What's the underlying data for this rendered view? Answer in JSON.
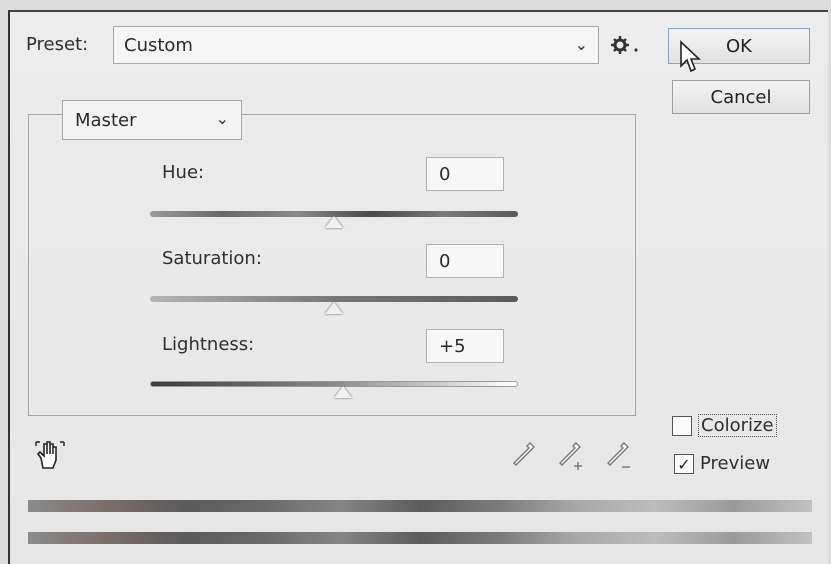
{
  "preset": {
    "label": "Preset:",
    "value": "Custom"
  },
  "buttons": {
    "ok": "OK",
    "cancel": "Cancel"
  },
  "channel": {
    "value": "Master"
  },
  "sliders": [
    {
      "label": "Hue:",
      "value": "0",
      "level": 0.5
    },
    {
      "label": "Saturation:",
      "value": "0",
      "level": 0.5
    },
    {
      "label": "Lightness:",
      "value": "+5",
      "level": 0.525
    }
  ],
  "options": {
    "colorize": "Colorize",
    "preview": "Preview",
    "colorize_checked": false,
    "preview_checked": true
  },
  "icons": [
    "chevron-down-icon",
    "gear-icon",
    "pointer-cursor-icon",
    "hand-adjust-icon",
    "eyedropper-icon",
    "eyedropper-plus-icon",
    "eyedropper-minus-icon",
    "checkmark-icon"
  ]
}
